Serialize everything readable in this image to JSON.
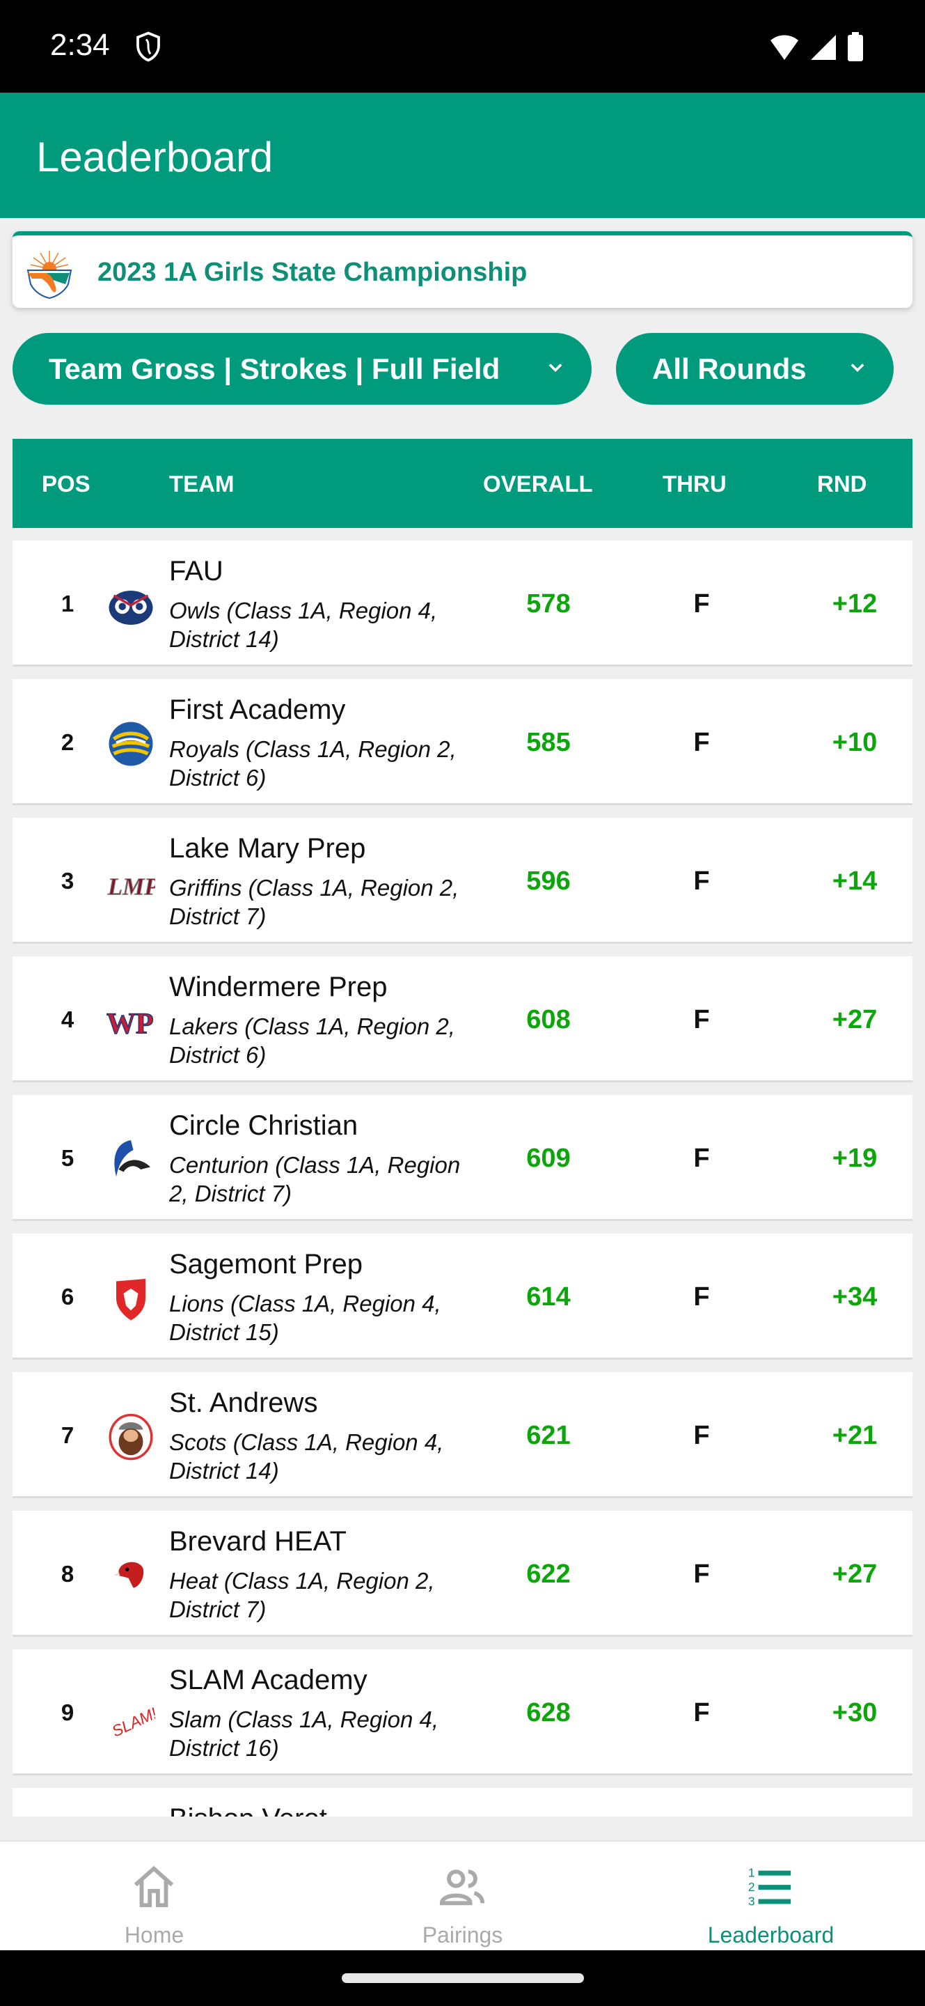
{
  "status_bar": {
    "time": "2:34"
  },
  "app_bar": {
    "title": "Leaderboard"
  },
  "tournament": {
    "name": "2023 1A Girls State Championship"
  },
  "filters": {
    "type": "Team Gross | Strokes | Full Field",
    "round": "All Rounds"
  },
  "table": {
    "headers": {
      "pos": "POS",
      "team": "TEAM",
      "overall": "OVERALL",
      "thru": "THRU",
      "rnd": "RND"
    },
    "rows": [
      {
        "pos": "1",
        "team": "FAU",
        "sub": "Owls (Class 1A, Region 4, District 14)",
        "overall": "578",
        "thru": "F",
        "rnd": "+12",
        "logo": "owl-logo"
      },
      {
        "pos": "2",
        "team": "First Academy",
        "sub": "Royals (Class 1A, Region 2, District 6)",
        "overall": "585",
        "thru": "F",
        "rnd": "+10",
        "logo": "lion-logo"
      },
      {
        "pos": "3",
        "team": "Lake Mary Prep",
        "sub": "Griffins (Class 1A, Region 2, District 7)",
        "overall": "596",
        "thru": "F",
        "rnd": "+14",
        "logo": "lmp-logo"
      },
      {
        "pos": "4",
        "team": "Windermere Prep",
        "sub": "Lakers (Class 1A, Region 2, District 6)",
        "overall": "608",
        "thru": "F",
        "rnd": "+27",
        "logo": "wp-logo"
      },
      {
        "pos": "5",
        "team": "Circle Christian",
        "sub": "Centurion (Class 1A, Region 2, District 7)",
        "overall": "609",
        "thru": "F",
        "rnd": "+19",
        "logo": "centurion-logo"
      },
      {
        "pos": "6",
        "team": "Sagemont Prep",
        "sub": "Lions (Class 1A, Region 4, District 15)",
        "overall": "614",
        "thru": "F",
        "rnd": "+34",
        "logo": "lion-shield-logo"
      },
      {
        "pos": "7",
        "team": "St. Andrews",
        "sub": "Scots (Class 1A, Region 4, District 14)",
        "overall": "621",
        "thru": "F",
        "rnd": "+21",
        "logo": "scot-logo"
      },
      {
        "pos": "8",
        "team": "Brevard HEAT",
        "sub": "Heat (Class 1A, Region 2, District 7)",
        "overall": "622",
        "thru": "F",
        "rnd": "+27",
        "logo": "hawk-logo"
      },
      {
        "pos": "9",
        "team": "SLAM Academy",
        "sub": "Slam (Class 1A, Region 4, District 16)",
        "overall": "628",
        "thru": "F",
        "rnd": "+30",
        "logo": "slam-logo"
      },
      {
        "pos": "",
        "team": "Bishop Verot",
        "sub": "",
        "overall": "",
        "thru": "",
        "rnd": "",
        "logo": ""
      }
    ]
  },
  "bottom_nav": {
    "items": [
      {
        "label": "Home",
        "icon": "home-icon",
        "active": false
      },
      {
        "label": "Pairings",
        "icon": "people-icon",
        "active": false
      },
      {
        "label": "Leaderboard",
        "icon": "ranked-list-icon",
        "active": true
      }
    ]
  },
  "colors": {
    "primary": "#009b7d",
    "score_green": "#0aa60a",
    "title_green": "#0e8f77"
  }
}
